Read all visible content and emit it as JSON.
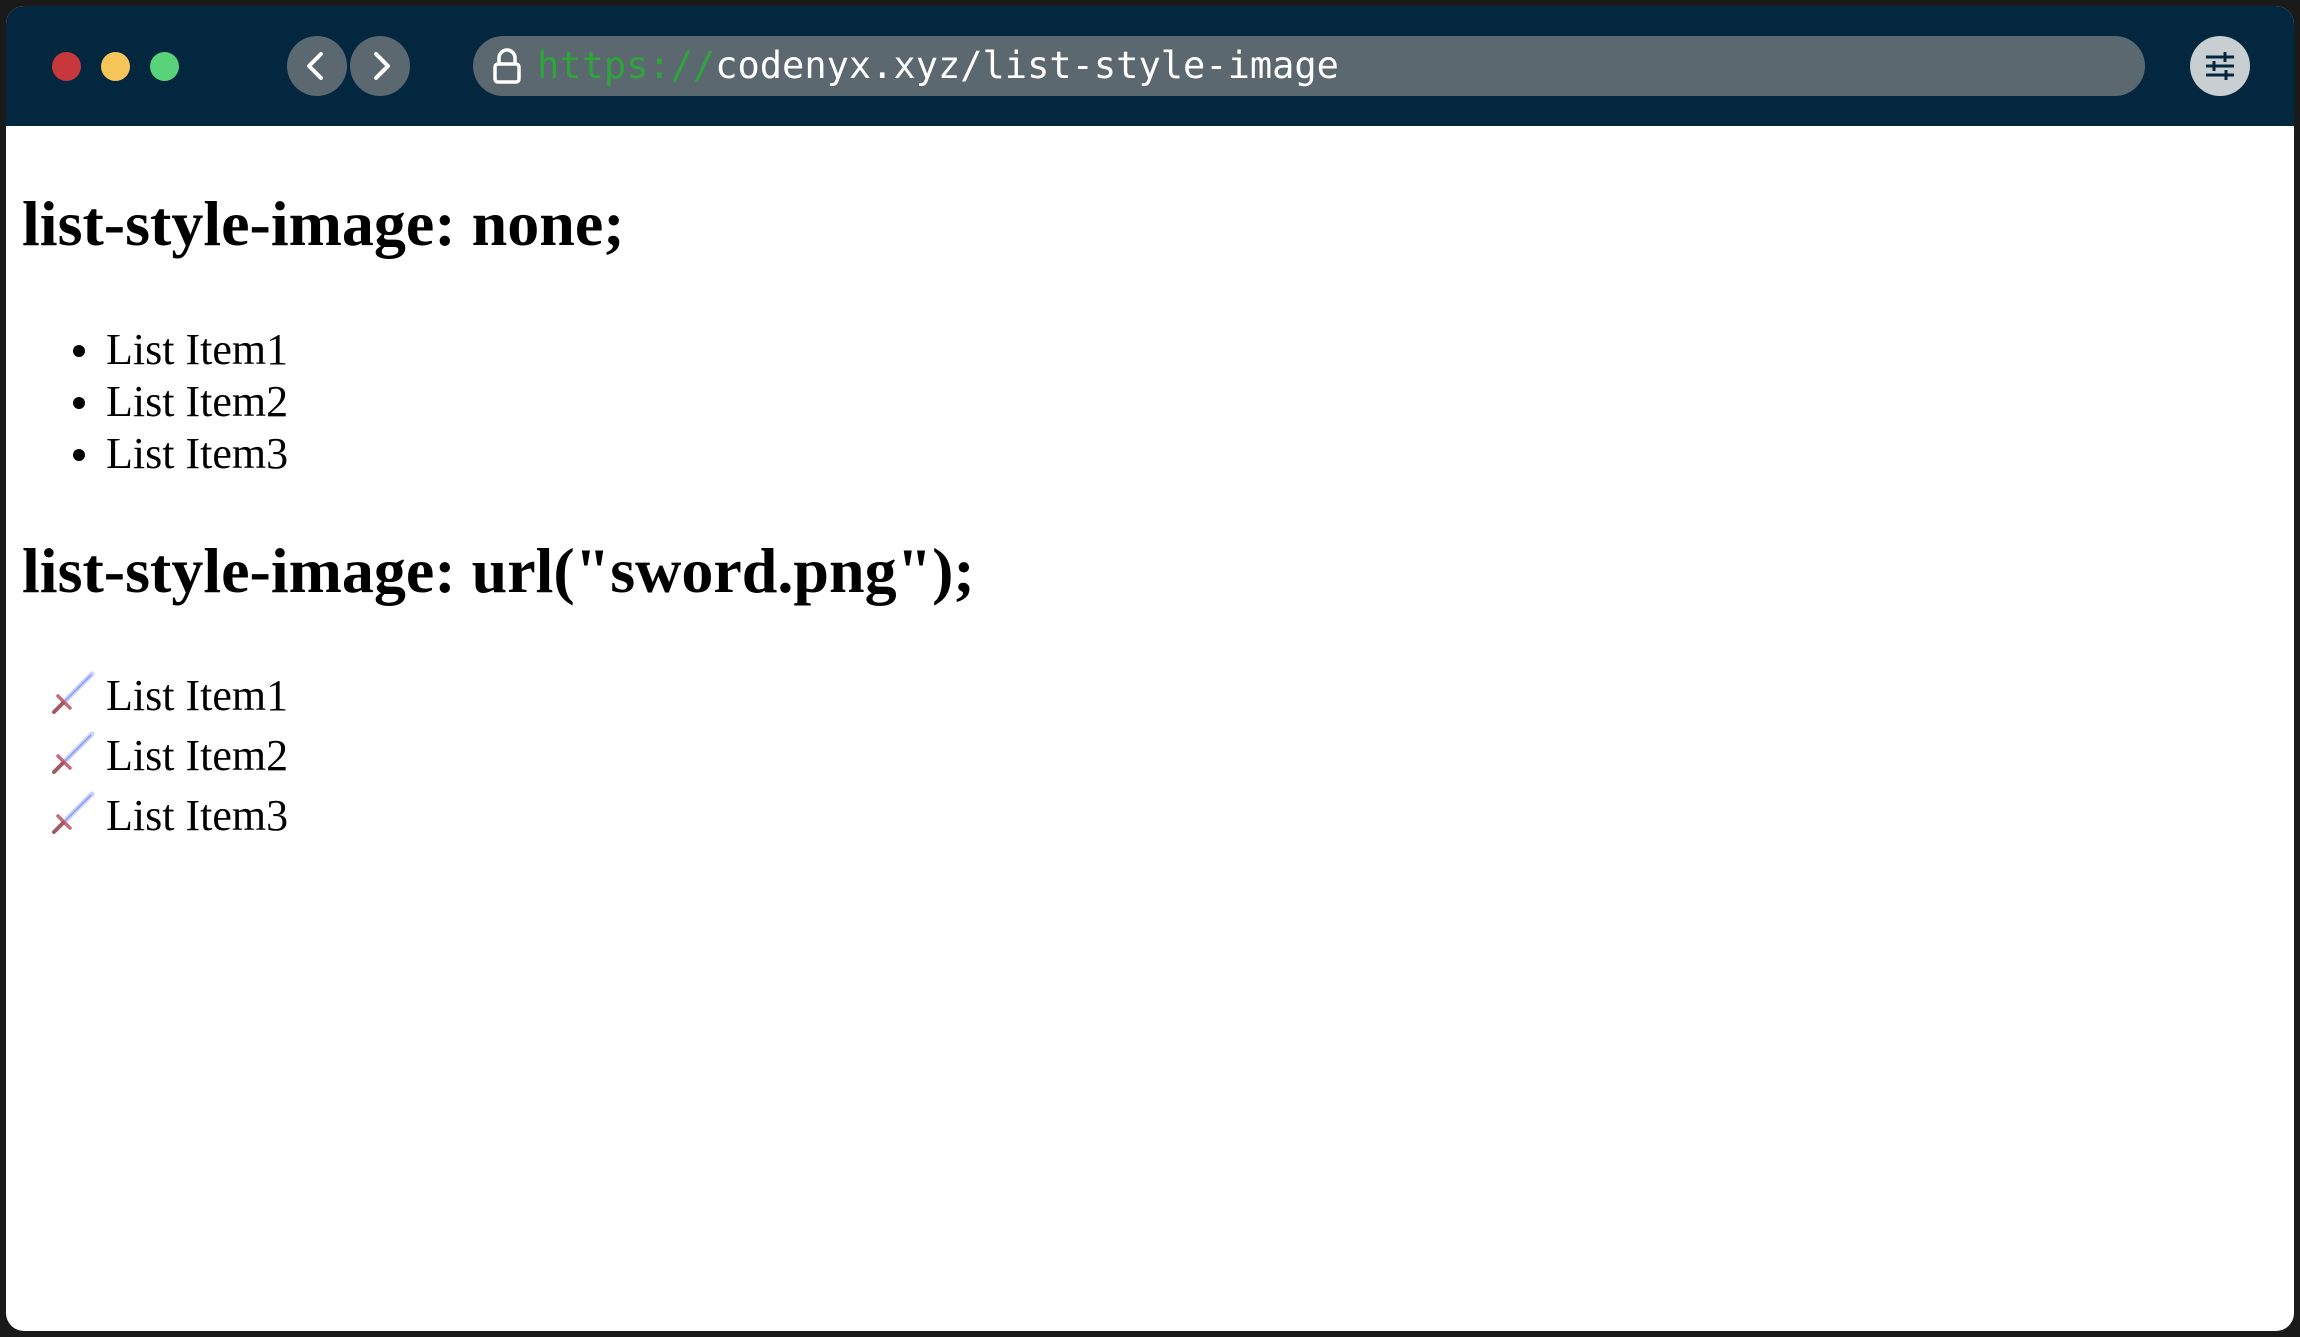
{
  "browser": {
    "url_scheme": "https://",
    "url_rest": "codenyx.xyz/list-style-image",
    "icons": {
      "back": "chevron-left-icon",
      "forward": "chevron-right-icon",
      "lock": "lock-icon",
      "settings": "sliders-icon"
    },
    "colors": {
      "titlebar": "#03273f",
      "urlbar": "#5b6870",
      "scheme": "#2fa33c",
      "close": "#c8373c",
      "minimize": "#f6c55a",
      "maximize": "#58d37a"
    }
  },
  "page": {
    "section_none": {
      "heading": "list-style-image: none;",
      "items": [
        "List Item1",
        "List Item2",
        "List Item3"
      ]
    },
    "section_sword": {
      "heading": "list-style-image: url(\"sword.png\");",
      "marker_icon": "sword-icon",
      "items": [
        "List Item1",
        "List Item2",
        "List Item3"
      ]
    }
  }
}
